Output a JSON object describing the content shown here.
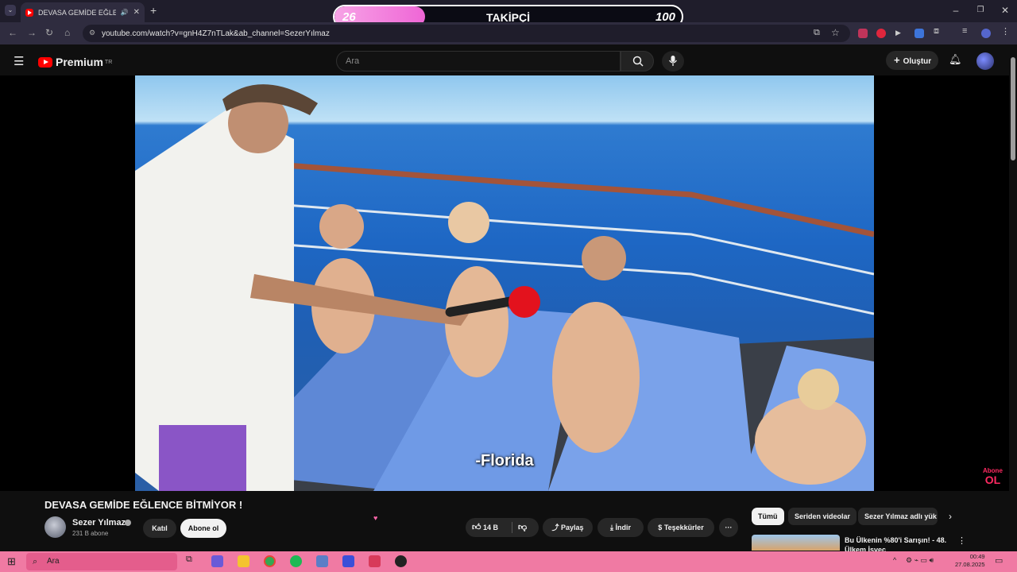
{
  "browser": {
    "tab_title": "DEVASA GEMİDE EĞLENCE",
    "url": "youtube.com/watch?v=gnH4Z7nTLak&ab_channel=SezerYılmaz"
  },
  "follower_overlay": {
    "current": "26",
    "label": "TAKİPÇİ",
    "goal": "100",
    "progress": 0.26
  },
  "youtube_header": {
    "logo_text": "Premium",
    "region": "TR",
    "search_placeholder": "Ara",
    "create_label": "Oluştur"
  },
  "video": {
    "subtitle": "-Florida",
    "overlay_logo_line1": "Abone",
    "overlay_logo_line2": "OL"
  },
  "video_info": {
    "title": "DEVASA GEMİDE EĞLENCE BİTMİYOR !",
    "channel_name": "Sezer Yılmaz",
    "subscribers": "231 B abone",
    "join_label": "Katıl",
    "subscribe_label": "Abone ol",
    "likes": "14 B",
    "share_label": "Paylaş",
    "download_label": "İndir",
    "thanks_label": "Teşekkürler",
    "more_label": "···"
  },
  "recommendations": {
    "chips": [
      "Tümü",
      "Seriden videolar",
      "Sezer Yılmaz adlı yük"
    ],
    "first_title": "Bu Ülkenin %80'i Sarışın! - 48. Ülkem İsveç"
  },
  "taskbar": {
    "search_placeholder": "Ara",
    "time": "00:49",
    "date": "27.08.2025"
  },
  "colors": {
    "youtube_red": "#ff0000",
    "taskbar": "#f07aa3",
    "overlay_pink": "#ef66d6"
  }
}
